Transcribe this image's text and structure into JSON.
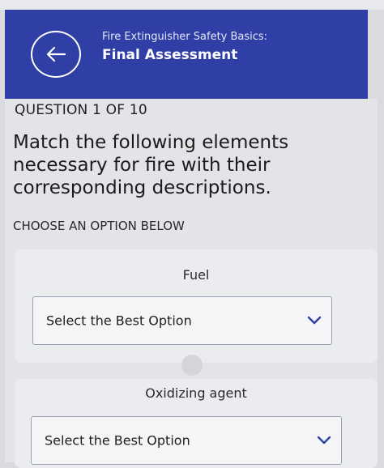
{
  "header": {
    "course_title": "Fire Extinguisher Safety Basics:",
    "screen_title": "Final Assessment",
    "back_icon": "arrow-left-icon"
  },
  "question": {
    "count_label": "QUESTION 1 OF 10",
    "line1": "Match the following elements",
    "line2": "necessary for fire with their",
    "line3": "corresponding descriptions."
  },
  "instructions": {
    "choose_label": "CHOOSE AN OPTION BELOW"
  },
  "items": [
    {
      "term": "Fuel",
      "select_value": "Select the Best Option"
    },
    {
      "term": "Oxidizing agent",
      "select_value": "Select the Best Option"
    }
  ],
  "colors": {
    "header_bg": "#2f3fa6",
    "select_border": "#9aa0b4",
    "chevron": "#2f3fa6"
  }
}
